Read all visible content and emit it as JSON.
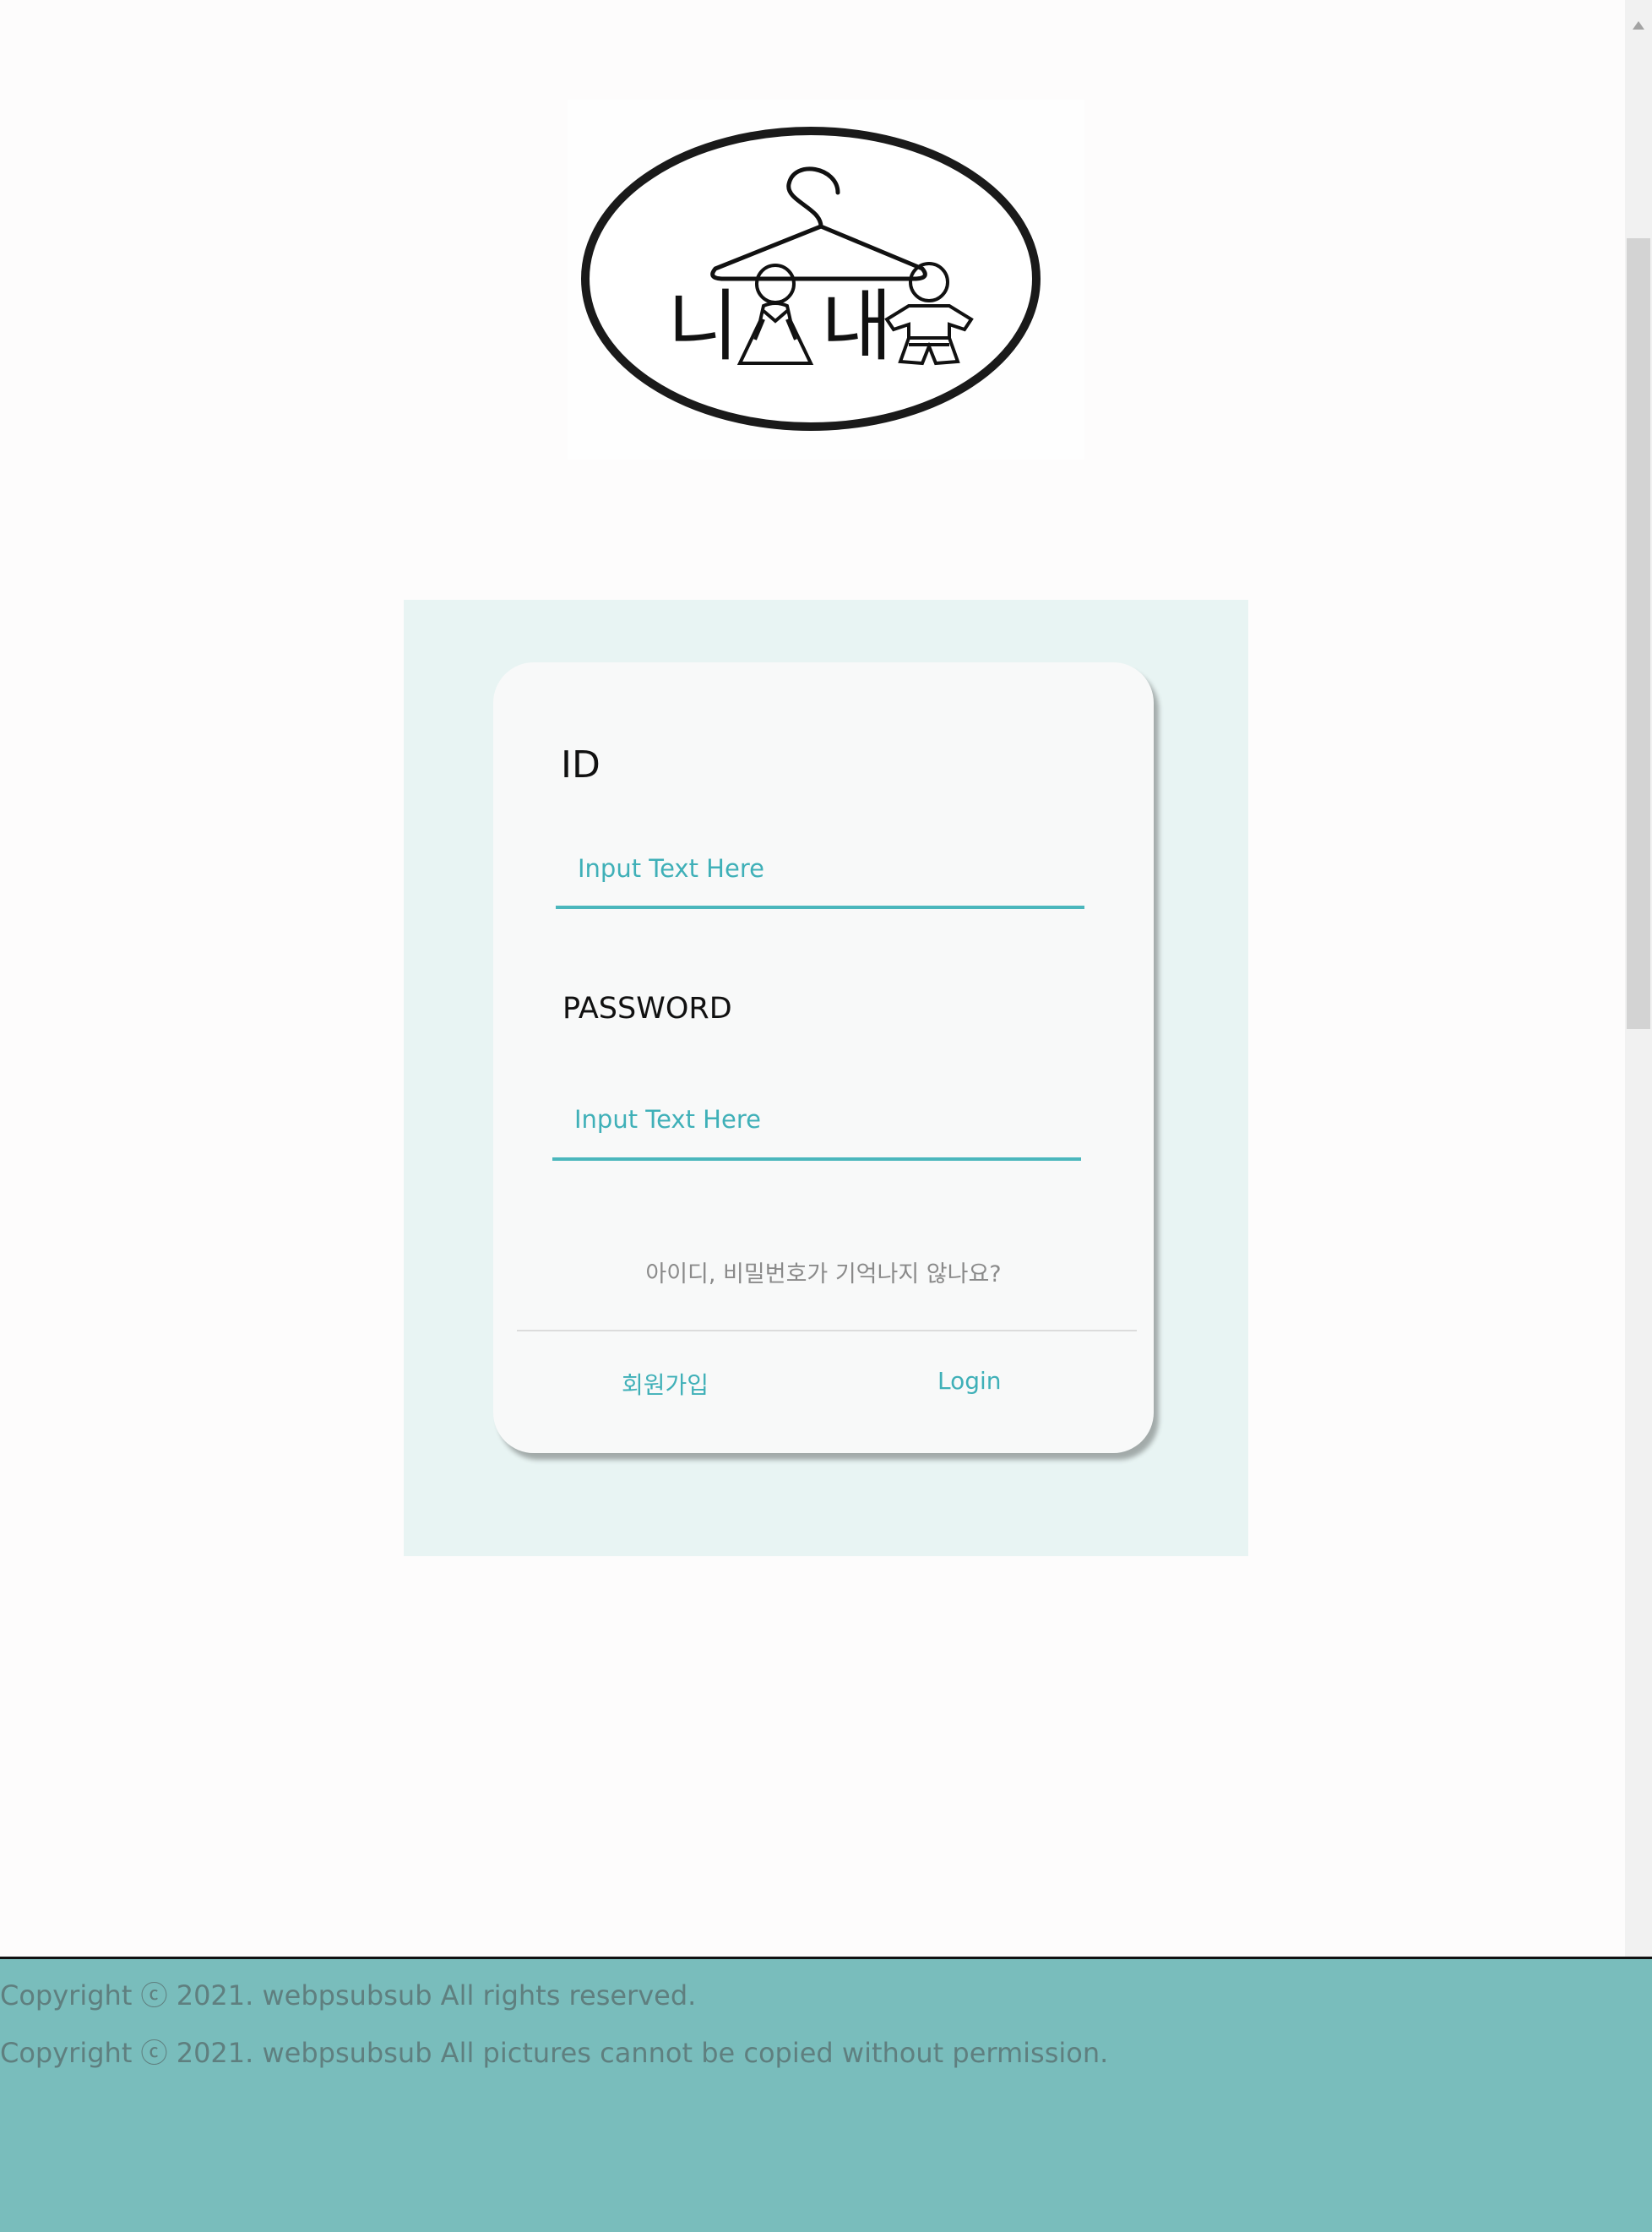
{
  "logo": {
    "text_left": "니",
    "text_right": "내"
  },
  "login": {
    "id_label": "ID",
    "id_placeholder": "Input Text Here",
    "password_label": "PASSWORD",
    "password_placeholder": "Input Text Here",
    "forgot_text": "아이디, 비밀번호가 기억나지 않나요?",
    "signup_label": "회원가입",
    "login_label": "Login"
  },
  "footer": {
    "line1": "Copyright ⓒ 2021. webpsubsub  All rights reserved.",
    "line2": "Copyright ⓒ 2021. webpsubsub  All pictures cannot be copied without permission."
  },
  "colors": {
    "accent": "#3fb0b8",
    "panel_background": "#e8f4f3",
    "footer_background": "#79bdbc"
  }
}
